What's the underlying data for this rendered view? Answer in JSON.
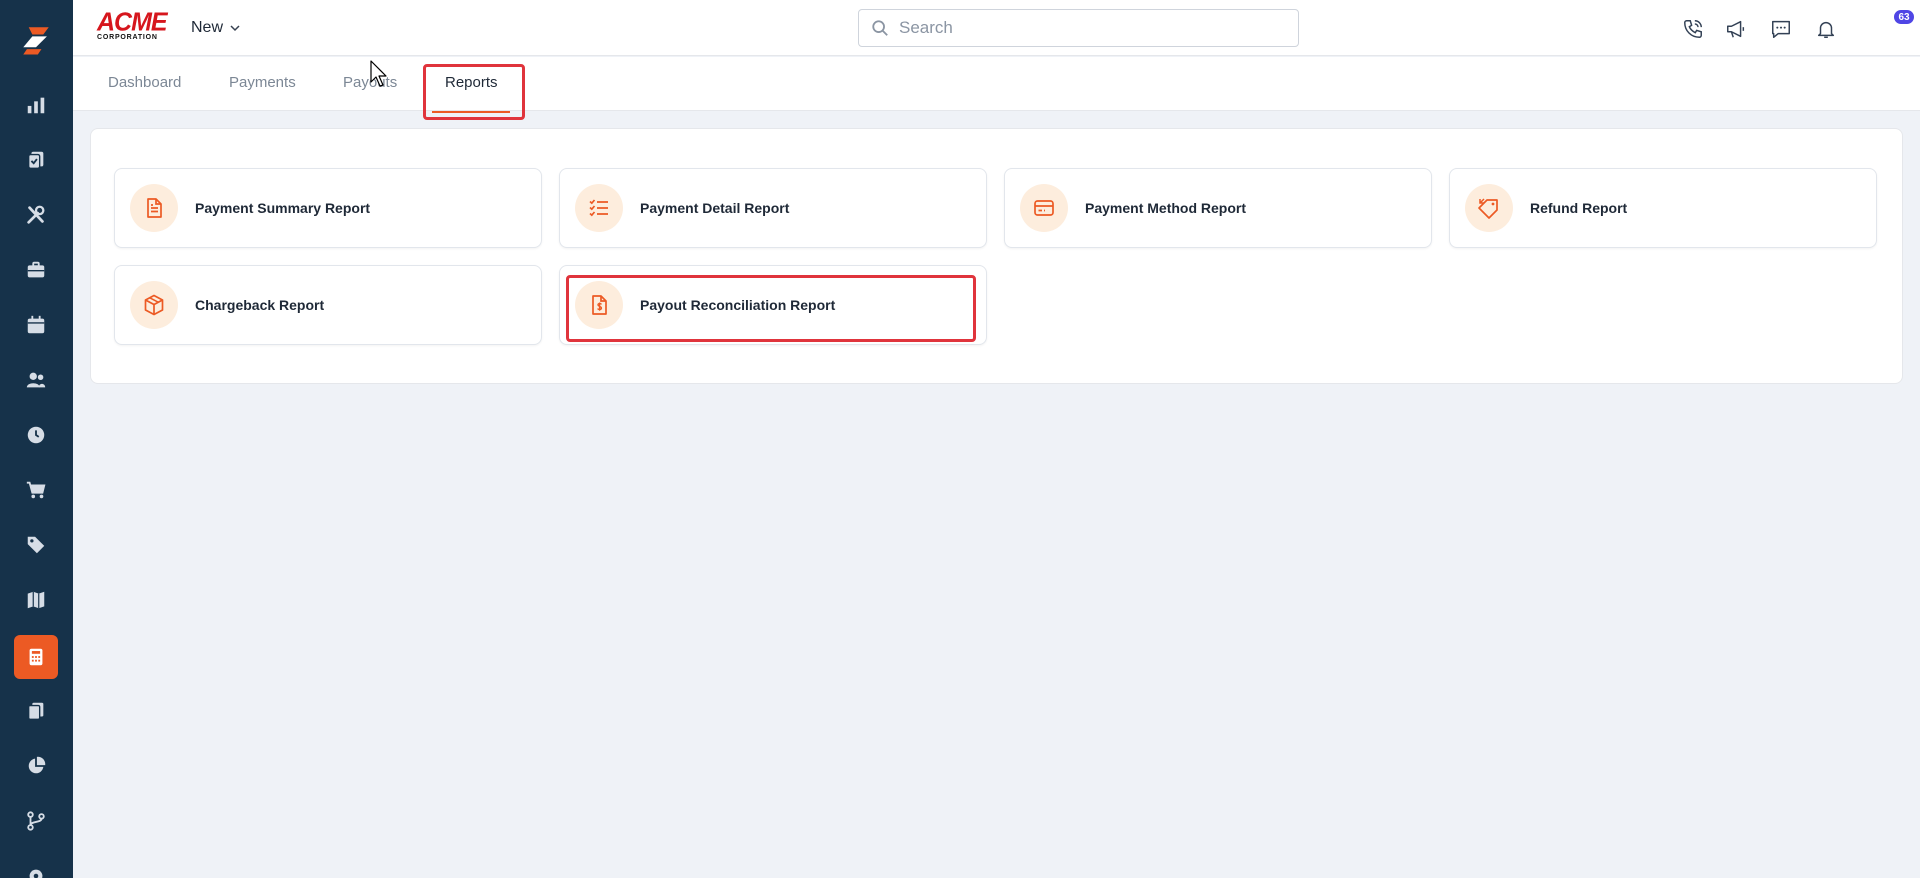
{
  "sidebar": {
    "items": [
      {
        "icon": "bar-chart-icon"
      },
      {
        "icon": "clipboard-check-icon"
      },
      {
        "icon": "tools-icon"
      },
      {
        "icon": "briefcase-icon"
      },
      {
        "icon": "calendar-icon"
      },
      {
        "icon": "users-icon"
      },
      {
        "icon": "clock-icon"
      },
      {
        "icon": "cart-icon"
      },
      {
        "icon": "tag-icon"
      },
      {
        "icon": "map-icon"
      },
      {
        "icon": "calculator-icon",
        "active": true
      },
      {
        "icon": "documents-icon"
      },
      {
        "icon": "pie-chart-icon"
      },
      {
        "icon": "branch-icon"
      },
      {
        "icon": "gear-icon"
      }
    ],
    "active_color": "#ec5a24",
    "background": "#16324a"
  },
  "header": {
    "brand_name": "ACME",
    "brand_sub": "CORPORATION",
    "new_label": "New",
    "search_placeholder": "Search",
    "notification_count": "63"
  },
  "tabs": [
    {
      "label": "Dashboard"
    },
    {
      "label": "Payments"
    },
    {
      "label": "Payouts"
    },
    {
      "label": "Reports",
      "active": true
    }
  ],
  "reports": [
    {
      "label": "Payment Summary Report",
      "icon": "document-icon"
    },
    {
      "label": "Payment Detail Report",
      "icon": "checklist-icon"
    },
    {
      "label": "Payment Method Report",
      "icon": "credit-card-icon"
    },
    {
      "label": "Refund Report",
      "icon": "tag-return-icon"
    },
    {
      "label": "Chargeback Report",
      "icon": "box-icon"
    },
    {
      "label": "Payout Reconciliation Report",
      "icon": "dollar-document-icon"
    }
  ],
  "colors": {
    "accent": "#ec5a24",
    "highlight": "#e0343c",
    "icon_bg": "#fdeddd"
  }
}
